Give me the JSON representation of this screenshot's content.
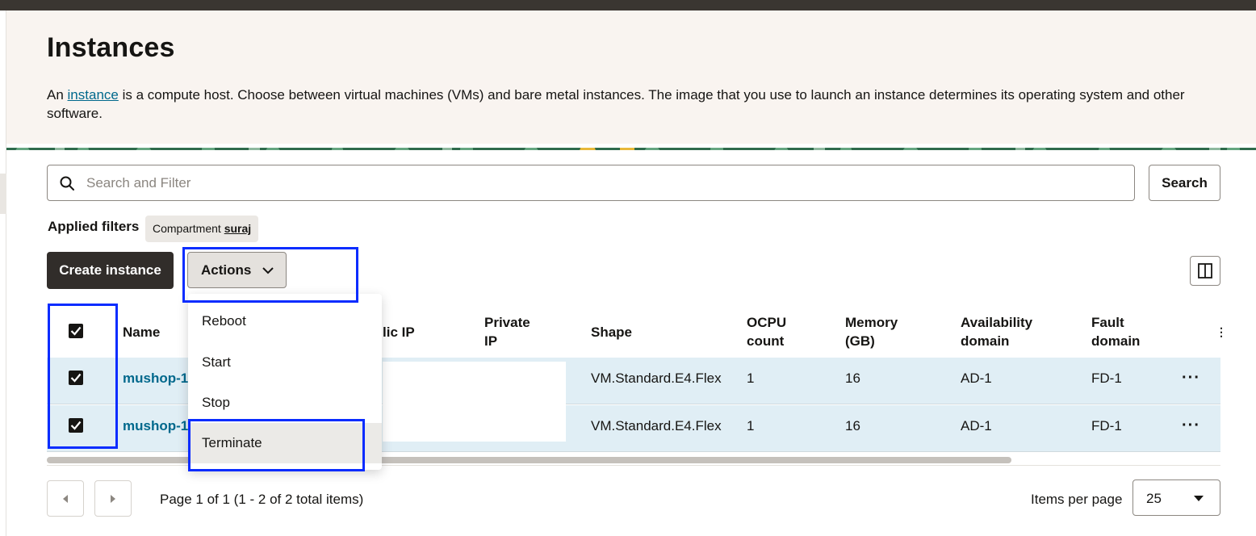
{
  "header": {
    "title": "Instances",
    "description_before": "An ",
    "description_link": "instance",
    "description_after": " is a compute host. Choose between virtual machines (VMs) and bare metal instances. The image that you use to launch an instance determines its operating system and other software."
  },
  "search": {
    "placeholder": "Search and Filter",
    "value": "",
    "button_label": "Search"
  },
  "filters": {
    "label": "Applied filters",
    "chip_key": "Compartment ",
    "chip_value": "suraj"
  },
  "toolbar": {
    "create_label": "Create instance",
    "actions_label": "Actions"
  },
  "actions_menu": {
    "items": [
      "Reboot",
      "Start",
      "Stop",
      "Terminate"
    ],
    "highlighted": "Terminate"
  },
  "table": {
    "columns": {
      "name": "Name",
      "public_ip": "lic IP",
      "private_ip": [
        "Private",
        "IP"
      ],
      "shape": "Shape",
      "ocpu": [
        "OCPU",
        "count"
      ],
      "memory": [
        "Memory",
        "(GB)"
      ],
      "availability": [
        "Availability",
        "domain"
      ],
      "fault": [
        "Fault",
        "domain"
      ],
      "more": "⋮"
    },
    "rows": [
      {
        "name": "mushop-1",
        "shape": "VM.Standard.E4.Flex",
        "ocpu": "1",
        "memory": "16",
        "availability": "AD-1",
        "fault": "FD-1",
        "selected": true,
        "more": "···"
      },
      {
        "name": "mushop-1",
        "shape": "VM.Standard.E4.Flex",
        "ocpu": "1",
        "memory": "16",
        "availability": "AD-1",
        "fault": "FD-1",
        "selected": true,
        "more": "···"
      }
    ],
    "all_selected": true
  },
  "pagination": {
    "page_text": "Page 1 of 1 (1 - 2 of 2 total items)",
    "items_per_page_label": "Items per page",
    "items_per_page_value": "25"
  },
  "colors": {
    "primary_button": "#312d2a",
    "link": "#00688c",
    "row_selected": "#e0eef5",
    "annotation": "#0a2cff"
  }
}
